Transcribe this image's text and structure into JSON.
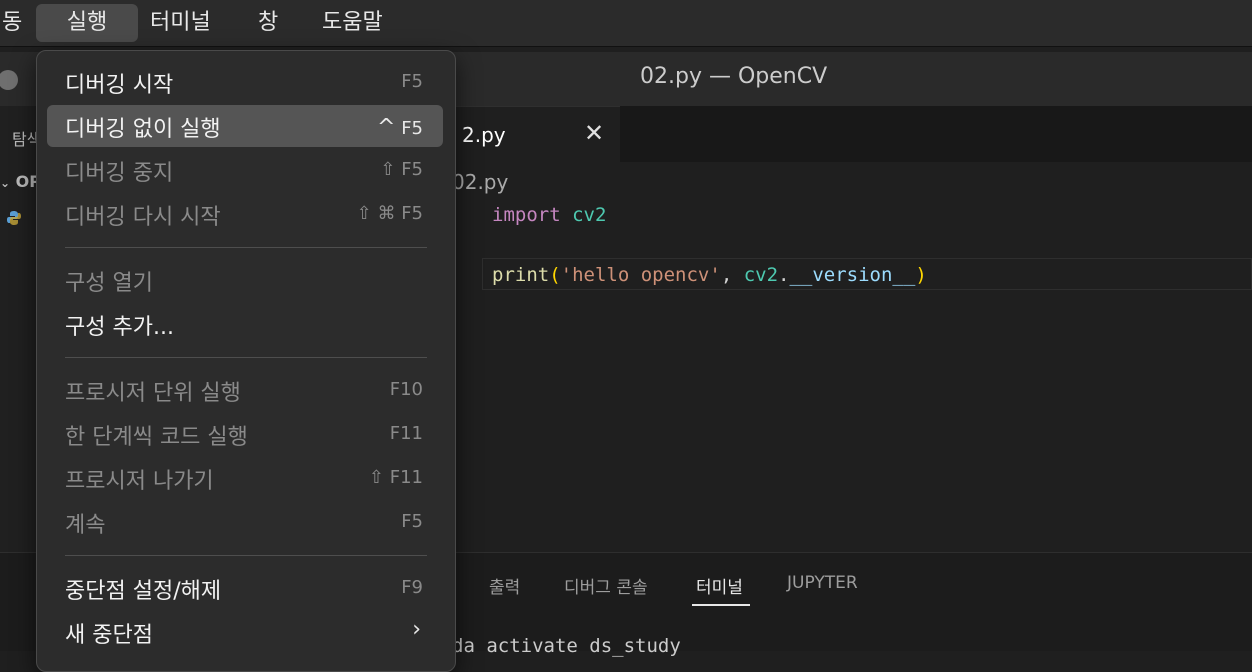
{
  "menubar": {
    "items": [
      {
        "label": "동"
      },
      {
        "label": "실행"
      },
      {
        "label": "터미널"
      },
      {
        "label": "창"
      },
      {
        "label": "도움말"
      }
    ]
  },
  "window": {
    "title": "02.py — OpenCV",
    "sidebar": {
      "explorer_label": "탐색",
      "folder_label": "OP"
    }
  },
  "editor": {
    "tab_label": "2.py",
    "breadcrumb": "02.py",
    "code": {
      "line1": {
        "keyword": "import",
        "module": "cv2"
      },
      "line3": {
        "func": "print",
        "open": "(",
        "string": "'hello opencv'",
        "comma": ", ",
        "obj": "cv2",
        "dot": ".",
        "attr": "__version__",
        "close": ")"
      }
    }
  },
  "panel": {
    "tabs": [
      {
        "label": "출력"
      },
      {
        "label": "디버그 콘솔"
      },
      {
        "label": "터미널"
      },
      {
        "label": "JUPYTER"
      }
    ],
    "terminal_text": "da activate ds_study"
  },
  "run_menu": {
    "items": [
      {
        "label": "디버깅 시작",
        "shortcut": "F5"
      },
      {
        "label": "디버깅 없이 실행",
        "shortcut_symbol": "^",
        "shortcut": "F5"
      },
      {
        "label": "디버깅 중지",
        "shortcut_symbol": "⇧",
        "shortcut": "F5"
      },
      {
        "label": "디버깅 다시 시작",
        "shortcut_symbol": "⇧ ⌘",
        "shortcut": "F5"
      },
      {
        "label": "구성 열기"
      },
      {
        "label": "구성 추가..."
      },
      {
        "label": "프로시저 단위 실행",
        "shortcut": "F10"
      },
      {
        "label": "한 단계씩 코드 실행",
        "shortcut": "F11"
      },
      {
        "label": "프로시저 나가기",
        "shortcut_symbol": "⇧",
        "shortcut": "F11"
      },
      {
        "label": "계속",
        "shortcut": "F5"
      },
      {
        "label": "중단점 설정/해제",
        "shortcut": "F9"
      },
      {
        "label": "새 중단점",
        "submenu_icon": "chevron-right-icon"
      }
    ]
  }
}
